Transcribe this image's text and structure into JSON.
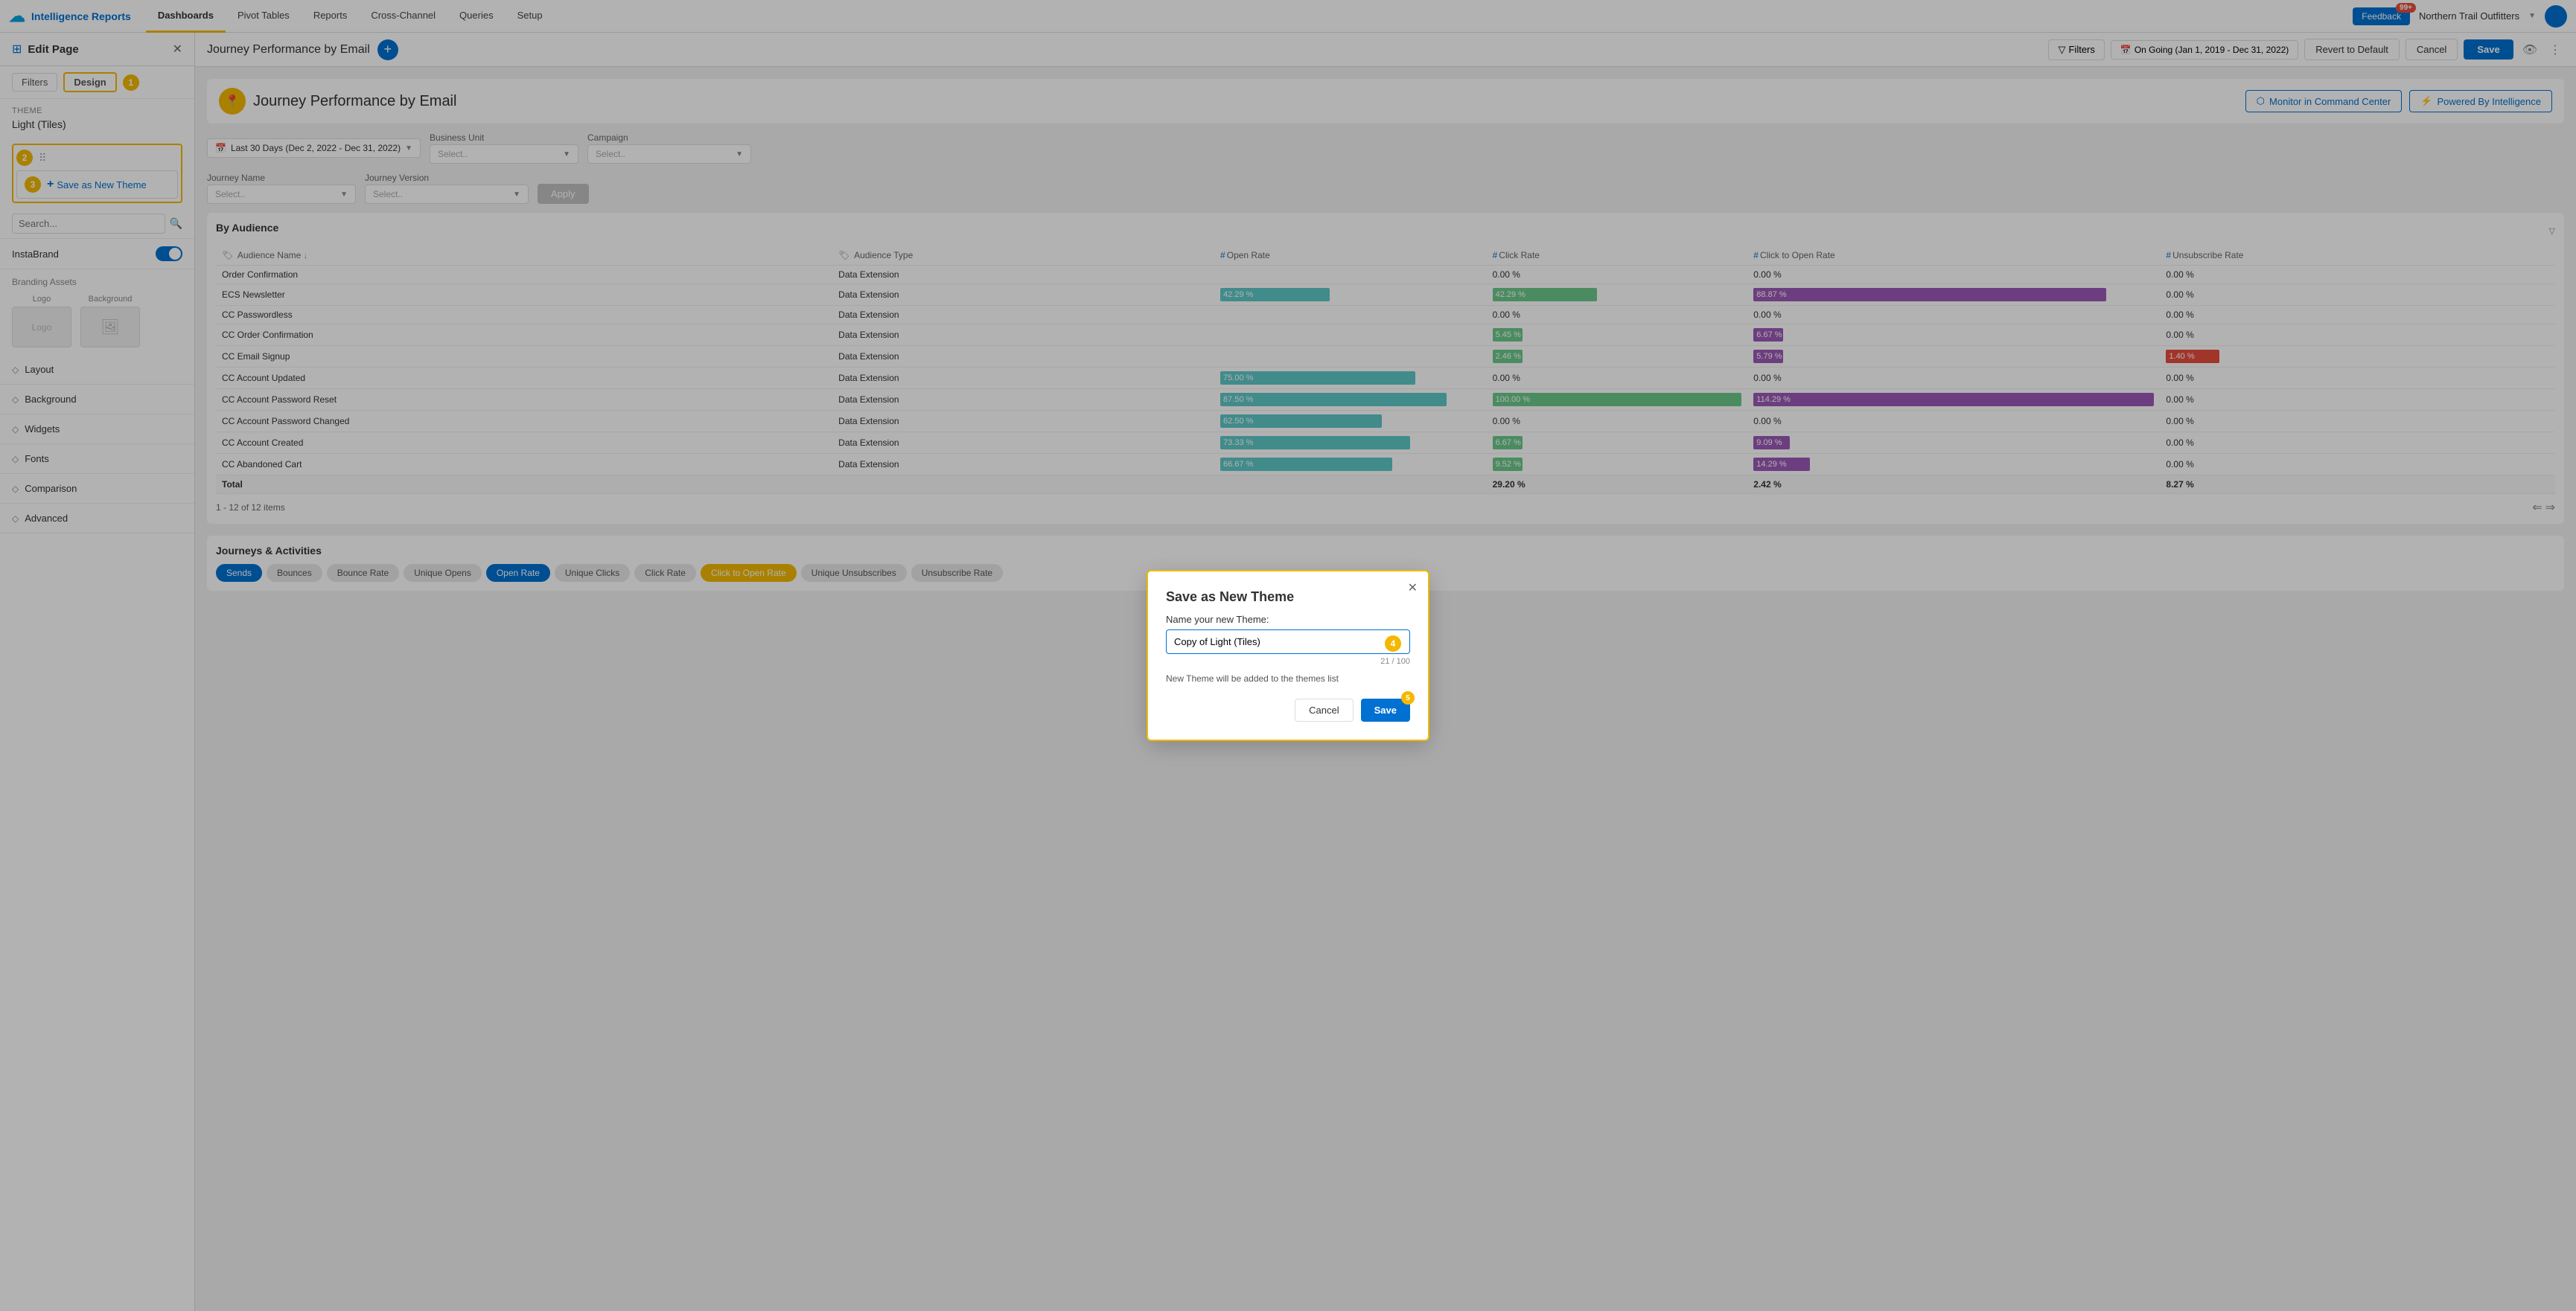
{
  "app": {
    "name": "Intelligence Reports",
    "logo_char": "☁"
  },
  "nav": {
    "tabs": [
      {
        "label": "Dashboards",
        "active": true
      },
      {
        "label": "Pivot Tables",
        "active": false
      },
      {
        "label": "Reports",
        "active": false
      },
      {
        "label": "Cross-Channel",
        "active": false
      },
      {
        "label": "Queries",
        "active": false
      },
      {
        "label": "Setup",
        "active": false
      }
    ],
    "feedback": "Feedback",
    "notification_count": "99+",
    "org_name": "Northern Trail Outfitters"
  },
  "sidebar": {
    "title": "Edit Page",
    "tabs": [
      {
        "label": "Filters",
        "active": false
      },
      {
        "label": "Design",
        "active": true
      }
    ],
    "step_design": "1",
    "theme_label": "THEME",
    "theme_name": "Light (Tiles)",
    "step_2": "2",
    "drag_handle": "⠿",
    "step_3": "3",
    "save_new_theme": "Save as New Theme",
    "search_placeholder": "Search...",
    "instabrand_label": "InstaBrand",
    "branding_label": "Branding Assets",
    "logo_label": "Logo",
    "background_label": "Background",
    "logo_placeholder": "Logo",
    "sections": [
      {
        "label": "Layout"
      },
      {
        "label": "Background"
      },
      {
        "label": "Widgets"
      },
      {
        "label": "Fonts"
      },
      {
        "label": "Comparison"
      },
      {
        "label": "Advanced"
      }
    ]
  },
  "page_header": {
    "title": "Journey Performance by Email",
    "filters_label": "Filters",
    "date_range": "On Going (Jan 1, 2019 - Dec 31, 2022)",
    "revert_label": "Revert to Default",
    "cancel_label": "Cancel",
    "save_label": "Save"
  },
  "dashboard": {
    "title": "Journey Performance by Email",
    "monitor_btn": "Monitor in Command Center",
    "powered_btn": "Powered By Intelligence",
    "date_filter": "Last 30 Days (Dec 2, 2022 - Dec 31, 2022)",
    "business_unit_label": "Business Unit",
    "business_unit_placeholder": "Select..",
    "campaign_label": "Campaign",
    "campaign_placeholder": "Select..",
    "journey_name_label": "Journey Name",
    "journey_name_placeholder": "Select..",
    "journey_version_label": "Journey Version",
    "journey_version_placeholder": "Select..",
    "apply_label": "Apply",
    "by_audience_title": "By Audience",
    "table_headers": [
      "Audience Name",
      "Audience Type",
      "Open Rate",
      "Click Rate",
      "Click to Open Rate",
      "Unsubscribe Rate"
    ],
    "table_rows": [
      {
        "name": "Order Confirmation",
        "type": "Data Extension",
        "open_rate": "",
        "click_rate": "0.00 %",
        "ctor": "0.00 %",
        "unsub": "0.00 %",
        "open_bar": 0,
        "click_bar": 0,
        "ctor_bar": 0,
        "unsub_bar": 0
      },
      {
        "name": "ECS Newsletter",
        "type": "Data Extension",
        "open_rate": "42.29 %",
        "click_rate": "42.29 %",
        "ctor": "88.87 %",
        "unsub": "0.00 %",
        "open_bar": 42,
        "click_bar": 42,
        "ctor_bar": 88,
        "unsub_bar": 0
      },
      {
        "name": "CC Passwordless",
        "type": "Data Extension",
        "open_rate": "",
        "click_rate": "0.00 %",
        "ctor": "0.00 %",
        "unsub": "0.00 %",
        "open_bar": 0,
        "click_bar": 0,
        "ctor_bar": 0,
        "unsub_bar": 0
      },
      {
        "name": "CC Order Confirmation",
        "type": "Data Extension",
        "open_rate": "",
        "click_rate": "5.45 %",
        "ctor": "6.67 %",
        "unsub": "0.00 %",
        "open_bar": 0,
        "click_bar": 5,
        "ctor_bar": 6,
        "unsub_bar": 0
      },
      {
        "name": "CC Email Signup",
        "type": "Data Extension",
        "open_rate": "",
        "click_rate": "2.46 %",
        "ctor": "5.79 %",
        "unsub": "1.40 %",
        "open_bar": 0,
        "click_bar": 2,
        "ctor_bar": 5,
        "unsub_bar": 14
      },
      {
        "name": "CC Account Updated",
        "type": "Data Extension",
        "open_rate": "75.00 %",
        "click_rate": "0.00 %",
        "ctor": "0.00 %",
        "unsub": "0.00 %",
        "open_bar": 75,
        "click_bar": 0,
        "ctor_bar": 0,
        "unsub_bar": 0
      },
      {
        "name": "CC Account Password Reset",
        "type": "Data Extension",
        "open_rate": "87.50 %",
        "click_rate": "100.00 %",
        "ctor": "114.29 %",
        "unsub": "0.00 %",
        "open_bar": 87,
        "click_bar": 100,
        "ctor_bar": 100,
        "unsub_bar": 0
      },
      {
        "name": "CC Account Password Changed",
        "type": "Data Extension",
        "open_rate": "62.50 %",
        "click_rate": "0.00 %",
        "ctor": "0.00 %",
        "unsub": "0.00 %",
        "open_bar": 62,
        "click_bar": 0,
        "ctor_bar": 0,
        "unsub_bar": 0
      },
      {
        "name": "CC Account Created",
        "type": "Data Extension",
        "open_rate": "73.33 %",
        "click_rate": "6.67 %",
        "ctor": "9.09 %",
        "unsub": "0.00 %",
        "open_bar": 73,
        "click_bar": 6,
        "ctor_bar": 9,
        "unsub_bar": 0
      },
      {
        "name": "CC Abandoned Cart",
        "type": "Data Extension",
        "open_rate": "66.67 %",
        "click_rate": "9.52 %",
        "ctor": "14.29 %",
        "unsub": "0.00 %",
        "open_bar": 66,
        "click_bar": 9,
        "ctor_bar": 14,
        "unsub_bar": 0
      },
      {
        "name": "Total",
        "type": "",
        "open_rate": "",
        "click_rate": "29.20 %",
        "ctor": "2.42 %",
        "unsub": "8.27 %",
        "open_bar": -1,
        "total": true
      }
    ],
    "pagination": "1 - 12 of 12 items",
    "journeys_title": "Journeys & Activities",
    "metric_tabs": [
      {
        "label": "Sends",
        "active": true,
        "style": "active"
      },
      {
        "label": "Bounces",
        "active": false,
        "style": "inactive"
      },
      {
        "label": "Bounce Rate",
        "active": false,
        "style": "inactive"
      },
      {
        "label": "Unique Opens",
        "active": false,
        "style": "inactive"
      },
      {
        "label": "Open Rate",
        "active": true,
        "style": "active"
      },
      {
        "label": "Unique Clicks",
        "active": false,
        "style": "inactive"
      },
      {
        "label": "Click Rate",
        "active": false,
        "style": "inactive"
      },
      {
        "label": "Click to Open Rate",
        "active": true,
        "style": "active-secondary"
      },
      {
        "label": "Unique Unsubscribes",
        "active": false,
        "style": "inactive"
      },
      {
        "label": "Unsubscribe Rate",
        "active": false,
        "style": "inactive"
      }
    ]
  },
  "modal": {
    "title": "Save as New Theme",
    "label": "Name your new Theme:",
    "input_value": "Copy of Light (Tiles)",
    "char_count": "21 / 100",
    "hint": "New Theme will be added to the themes list",
    "cancel_label": "Cancel",
    "save_label": "Save",
    "step": "4",
    "save_step": "5"
  },
  "colors": {
    "open_bar": "#5ec8c8",
    "click_bar": "#6bc98a",
    "ctor_bar": "#9b59b6",
    "unsub_bar": "#e74c3c",
    "brand": "#0070d2",
    "accent": "#f4b800"
  }
}
